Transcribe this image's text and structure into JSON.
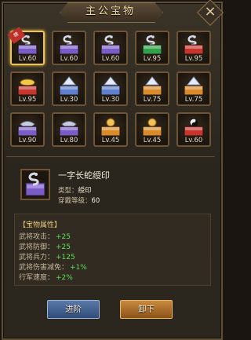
{
  "title": "主公宝物",
  "close_label": "×",
  "treasures": [
    {
      "lv": "Lv.60",
      "color": "#7b5cc6",
      "kind": "snake",
      "selected": true,
      "badge": "精"
    },
    {
      "lv": "Lv.60",
      "color": "#7b5cc6",
      "kind": "snake",
      "selected": false
    },
    {
      "lv": "Lv.60",
      "color": "#7b5cc6",
      "kind": "snake",
      "selected": false
    },
    {
      "lv": "Lv.95",
      "color": "#31a24b",
      "kind": "snake",
      "selected": false
    },
    {
      "lv": "Lv.95",
      "color": "#c7352f",
      "kind": "snake",
      "selected": false
    },
    {
      "lv": "Lv.95",
      "color": "#c7352f",
      "kind": "ingot",
      "selected": false
    },
    {
      "lv": "Lv.30",
      "color": "#5f7fcf",
      "kind": "ship",
      "selected": false
    },
    {
      "lv": "Lv.30",
      "color": "#5f7fcf",
      "kind": "ship",
      "selected": false
    },
    {
      "lv": "Lv.75",
      "color": "#d98b2a",
      "kind": "ship",
      "selected": false
    },
    {
      "lv": "Lv.75",
      "color": "#d98b2a",
      "kind": "ship",
      "selected": false
    },
    {
      "lv": "Lv.90",
      "color": "#7b5cc6",
      "kind": "lamp",
      "selected": false
    },
    {
      "lv": "Lv.80",
      "color": "#7b5cc6",
      "kind": "lamp",
      "selected": false
    },
    {
      "lv": "Lv.45",
      "color": "#d98b2a",
      "kind": "orb",
      "selected": false
    },
    {
      "lv": "Lv.45",
      "color": "#d98b2a",
      "kind": "orb",
      "selected": false
    },
    {
      "lv": "Lv.60",
      "color": "#c7352f",
      "kind": "yin",
      "selected": false
    }
  ],
  "detail": {
    "name": "一字长蛇绶印",
    "type_label": "类型：",
    "type_value": "绶印",
    "req_label": "穿戴等级：",
    "req_value": "60"
  },
  "attributes": {
    "title": "【宝物属性】",
    "items": [
      {
        "label": "武将攻击：",
        "value": "+25"
      },
      {
        "label": "武将防御：",
        "value": "+25"
      },
      {
        "label": "武将兵力：",
        "value": "+125"
      },
      {
        "label": "武将伤害减免：",
        "value": "+1%"
      },
      {
        "label": "行军速度：",
        "value": "+2%"
      }
    ]
  },
  "buttons": {
    "upgrade": "进阶",
    "unequip": "卸下"
  }
}
